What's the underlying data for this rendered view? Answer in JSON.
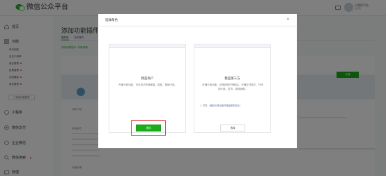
{
  "topbar": {
    "logo_text": "微信公众平台",
    "user_name": "小程序平台",
    "user_sub": "运营者"
  },
  "sidebar": {
    "sections": [
      {
        "label": "首页",
        "icon": "home-icon"
      },
      {
        "label": "功能",
        "icon": "function-icon"
      },
      {
        "label": "小程序",
        "icon": "miniprogram-icon"
      },
      {
        "label": "微信支付",
        "icon": "wechat-pay-icon"
      },
      {
        "label": "企业微信",
        "icon": "enterprise-wechat-icon"
      },
      {
        "label": "微信搜索",
        "icon": "wechat-search-icon"
      },
      {
        "label": "管理",
        "icon": "manage-icon"
      }
    ],
    "sub_items": [
      "自动回复",
      "自定义菜单",
      "留言管理",
      "投票管理",
      "页面模板",
      "原创管理"
    ],
    "add_plugin_label": "+ 添加功能插件"
  },
  "content": {
    "title": "添加功能插件",
    "tabs": [
      "插件库",
      "我的插件"
    ],
    "breadcrumb": "添加功能插件 / 功能详情",
    "apply_label": "开通",
    "side_texts": [
      "功能介绍",
      "申请条件",
      "开通步骤"
    ]
  },
  "dialog": {
    "title": "选择角色",
    "close_glyph": "×",
    "options": [
      {
        "title": "我是商户",
        "desc": "开通卡券功能，可为自己的商家建、投放、核销卡券。",
        "button": "选择"
      },
      {
        "title": "我是第三方",
        "desc": "开通卡券功能，应得到商户授权后，可通过开放平、开代制卡券、发货、券核销券。",
        "agree_prefix": "同意",
        "agree_link": "《微信卡券功能开放者服务协议》",
        "button": "选择"
      }
    ]
  },
  "colors": {
    "accent": "#1aad19",
    "highlight": "#e64340",
    "link": "#576b95"
  }
}
